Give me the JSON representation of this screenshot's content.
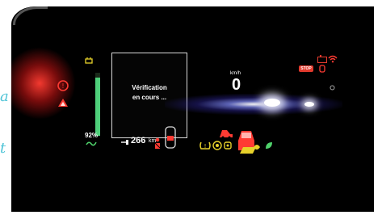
{
  "display": {
    "message_line1": "Vérification",
    "message_line2": "en cours ...",
    "speed_unit": "km/h",
    "speed_value": "0",
    "range_value": "266",
    "range_unit": "km",
    "battery_percent": "92%",
    "battery_level": 0.92,
    "stop_badge": "STOP"
  },
  "page_edge_text": {
    "left_fragment": "a",
    "right_fragment": "t"
  },
  "colors": {
    "warning_red": "#e23a2d",
    "accent_green": "#4fd16b",
    "indicator_yellow": "#e7d12a",
    "overlay_cyan": "#4ec3d6"
  },
  "icons": {
    "left_cluster": [
      "brake-warning-icon",
      "hazard-triangle-icon"
    ],
    "top_right": [
      "stop-badge",
      "battery-charge-icon",
      "engine-warning-icon",
      "wifi-icon"
    ],
    "bottom": [
      "fuel-pump-icon",
      "seatbelt-icon",
      "door-open-car-icon",
      "tire-pressure-icon",
      "abs-icon",
      "traction-icon",
      "light-icon"
    ],
    "gauge_icons": [
      "plug-icon",
      "ev-charge-icon"
    ]
  }
}
